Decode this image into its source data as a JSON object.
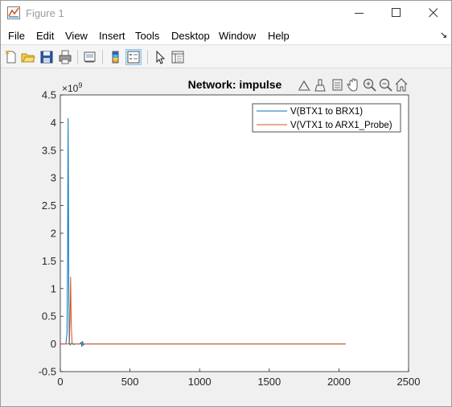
{
  "window": {
    "title": "Figure 1"
  },
  "menu": [
    "File",
    "Edit",
    "View",
    "Insert",
    "Tools",
    "Desktop",
    "Window",
    "Help"
  ],
  "menu_overflow": "↘",
  "toolbar": {
    "icons": [
      "new-figure-icon",
      "open-icon",
      "save-icon",
      "print-icon",
      "link-plot-icon",
      "colorbar-icon",
      "legend-icon",
      "pointer-icon",
      "property-inspector-icon"
    ],
    "active": "legend-icon"
  },
  "axes_toolbar": {
    "icons": [
      "export-icon",
      "brush-icon",
      "data-tips-icon",
      "pan-icon",
      "zoom-in-icon",
      "zoom-out-icon",
      "home-icon"
    ]
  },
  "colors": {
    "series1": "#0072bd",
    "series2": "#d95319"
  },
  "chart_data": {
    "type": "line",
    "title": "Network: impulse",
    "xlabel": "",
    "ylabel": "",
    "exponent_label": "×10",
    "exponent_power": "9",
    "xlim": [
      0,
      2500
    ],
    "ylim": [
      -0.5,
      4.5
    ],
    "x_ticks": [
      "0",
      "500",
      "1000",
      "1500",
      "2000",
      "2500"
    ],
    "y_ticks": [
      "-0.5",
      "0",
      "0.5",
      "1",
      "1.5",
      "2",
      "2.5",
      "3",
      "3.5",
      "4",
      "4.5"
    ],
    "grid": false,
    "legend_position": "top-right",
    "series": [
      {
        "name": "V(BTX1 to BRX1)",
        "x": [
          0,
          40,
          48,
          52,
          56,
          60,
          64,
          70,
          80,
          100,
          140,
          150,
          155,
          160,
          165,
          170,
          200,
          500,
          1000,
          1500,
          2048
        ],
        "y": [
          0,
          0,
          0.2,
          1.5,
          4.08,
          1.2,
          0.05,
          -0.02,
          0.01,
          0,
          0,
          0.03,
          -0.05,
          0.05,
          -0.02,
          0,
          0,
          0,
          0,
          0,
          0
        ]
      },
      {
        "name": "V(VTX1 to ARX1_Probe)",
        "x": [
          0,
          60,
          66,
          70,
          74,
          78,
          84,
          92,
          110,
          200,
          500,
          1000,
          1500,
          2048
        ],
        "y": [
          0,
          0,
          0.05,
          0.5,
          1.21,
          0.4,
          0.02,
          -0.01,
          0,
          0,
          0,
          0,
          0,
          0
        ]
      }
    ]
  }
}
